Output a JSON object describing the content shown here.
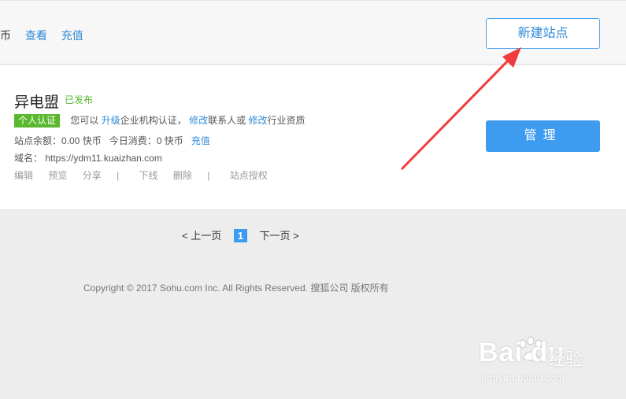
{
  "topbar": {
    "coin_text": "币",
    "view_link": "查看",
    "recharge_link": "充值",
    "new_site_button": "新建站点"
  },
  "site": {
    "name": "异电盟",
    "status": "已发布",
    "badge": "个人认证",
    "you_can": "您可以",
    "upgrade_link": "升级",
    "enterprise_text": "企业机构认证，",
    "modify_link1": "修改",
    "contact_text": "联系人或",
    "modify_link2": "修改",
    "qualification_text": "行业资质",
    "balance_text": "站点余额：0.00 快币",
    "today_text": "今日消费：0 快币",
    "recharge_link": "充值",
    "domain_text": "域名： https://ydm11.kuaizhan.com",
    "actions": {
      "edit": "编辑",
      "preview": "预览",
      "share": "分享",
      "offline": "下线",
      "delete": "删除",
      "authorize": "站点授权"
    },
    "separator": "|",
    "manage_button": "管理"
  },
  "pager": {
    "prev": "< 上一页",
    "current": "1",
    "next": "下一页 >"
  },
  "footer": {
    "copyright": "Copyright © 2017 Sohu.com Inc. All Rights Reserved. 搜狐公司 版权所有"
  },
  "watermark": {
    "main": "Bai du",
    "cn": "经验",
    "sub": "jingyan.baidu.com"
  },
  "colors": {
    "accent": "#3d9bf0",
    "link": "#2e8bd8",
    "badge": "#5ab82d",
    "arrow": "#f03c3c"
  }
}
